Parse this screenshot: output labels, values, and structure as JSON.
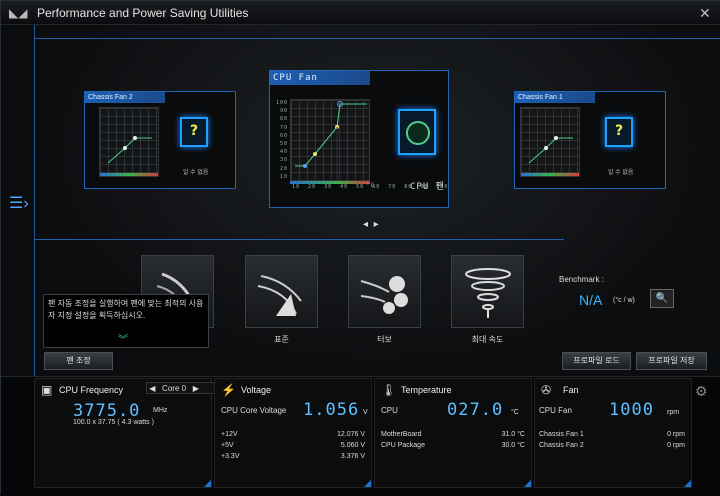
{
  "window": {
    "title": "Performance and Power Saving Utilities"
  },
  "cards": {
    "left": {
      "title": "Chassis Fan 2",
      "unknown": "알 수 없음"
    },
    "center": {
      "title": "CPU Fan",
      "label": "CPU 팬",
      "yticks": [
        "100",
        "90",
        "80",
        "70",
        "60",
        "50",
        "40",
        "30",
        "20",
        "10"
      ],
      "xticks": "10  20  30  40  50  60  70  80  90  100",
      "unit": "°C"
    },
    "right": {
      "title": "Chassis Fan 1",
      "unknown": "알 수 없음"
    }
  },
  "modes": [
    {
      "label": ""
    },
    {
      "label": "표준"
    },
    {
      "label": "터보"
    },
    {
      "label": "최대 속도"
    }
  ],
  "tooltip": {
    "text": "팬 자동 조정을 실행하여 팬에 맞는 최적의 사용자 지정 설정을 획득하십시오."
  },
  "buttons": {
    "fan_tune": "팬 조정",
    "load_profile": "프로파일 로드",
    "save_profile": "프로파일 저장"
  },
  "benchmark": {
    "label": "Benchmark :",
    "value": "N/A",
    "unit": "(°c / w)"
  },
  "cpu": {
    "title": "CPU Frequency",
    "core_select": "Core 0",
    "freq": "3775.0",
    "freq_unit": "MHz",
    "detail": "100.0  x  37.75 ( 4.3     watts )"
  },
  "voltage": {
    "title": "Voltage",
    "main_label": "CPU Core Voltage",
    "main_value": "1.056",
    "main_unit": "V",
    "rows": [
      {
        "label": "+12V",
        "value": "12.076 V"
      },
      {
        "label": "+5V",
        "value": "5.060 V"
      },
      {
        "label": "+3.3V",
        "value": "3.376 V"
      }
    ]
  },
  "temperature": {
    "title": "Temperature",
    "main_label": "CPU",
    "main_value": "027.0",
    "main_unit": "°C",
    "rows": [
      {
        "label": "MotherBoard",
        "value": "31.0 °C"
      },
      {
        "label": "CPU Package",
        "value": "30.0 °C"
      }
    ]
  },
  "fan": {
    "title": "Fan",
    "main_label": "CPU Fan",
    "main_value": "1000",
    "main_unit": "rpm",
    "rows": [
      {
        "label": "Chassis Fan 1",
        "value": "0  rpm"
      },
      {
        "label": "Chassis Fan 2",
        "value": "0  rpm"
      }
    ]
  },
  "colors": {
    "accent": "#1f66b8",
    "value": "#5fbfff",
    "curve": "#4fd08a"
  },
  "icons": [
    "rog-logo-icon",
    "close-icon",
    "menu-icon",
    "question-icon",
    "cpu-fan-icon",
    "chevron-left-icon",
    "chevron-right-icon",
    "silent-mode-icon",
    "standard-mode-icon",
    "turbo-mode-icon",
    "full-speed-mode-icon",
    "chevron-down-icon",
    "benchmark-icon",
    "cpu-icon",
    "lightning-icon",
    "thermometer-icon",
    "fan-icon",
    "gear-icon"
  ]
}
